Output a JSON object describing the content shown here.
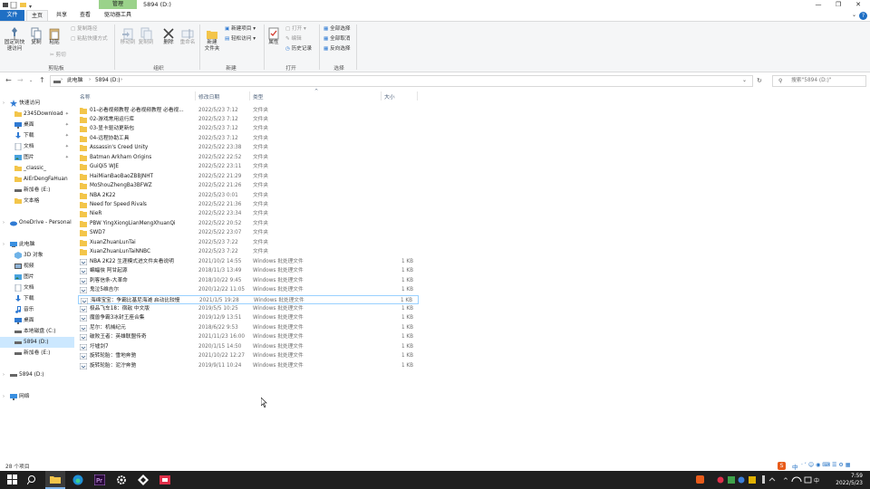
{
  "window": {
    "title": "5894 (D:)",
    "contextual_tab": "管理",
    "buttons": {
      "minimize": "—",
      "restore": "❐",
      "close": "✕"
    }
  },
  "ribbon_tabs": [
    "文件",
    "主页",
    "共享",
    "查看",
    "驱动器工具"
  ],
  "ribbon": {
    "clipboard": {
      "pin": "固定到快\n速访问",
      "copy": "复制",
      "paste": "粘贴",
      "copy_path": "复制路径",
      "paste_shortcut": "粘贴快捷方式",
      "cut": "剪切",
      "label": "剪贴板"
    },
    "organize": {
      "move_to": "移动到",
      "copy_to": "复制到",
      "delete": "删除",
      "rename": "重命名",
      "label": "组织"
    },
    "new": {
      "new_folder": "新建\n文件夹",
      "new_item": "新建项目 ▾",
      "easy_access": "轻松访问 ▾",
      "label": "新建"
    },
    "open": {
      "properties": "属性",
      "open": "打开 ▾",
      "edit": "编辑",
      "history": "历史记录",
      "label": "打开"
    },
    "select": {
      "select_all": "全部选择",
      "select_none": "全部取消",
      "invert": "反向选择",
      "label": "选择"
    }
  },
  "address": {
    "crumbs": [
      "此电脑",
      "5894 (D:)"
    ],
    "search_placeholder": "搜索\"5894 (D:)\""
  },
  "nav_pane": [
    {
      "label": "快速访问",
      "icon": "star-icon",
      "indent": 0,
      "pin": false
    },
    {
      "label": "2345Download",
      "icon": "folder-icon",
      "indent": 1,
      "pin": true
    },
    {
      "label": "桌面",
      "icon": "desktop-icon",
      "indent": 1,
      "pin": true
    },
    {
      "label": "下载",
      "icon": "download-icon",
      "indent": 1,
      "pin": true
    },
    {
      "label": "文档",
      "icon": "document-icon",
      "indent": 1,
      "pin": true
    },
    {
      "label": "图片",
      "icon": "picture-icon",
      "indent": 1,
      "pin": true
    },
    {
      "label": "_classic_",
      "icon": "folder-icon",
      "indent": 1,
      "pin": false
    },
    {
      "label": "AiErDengFaHuan",
      "icon": "folder-icon",
      "indent": 1,
      "pin": false
    },
    {
      "label": "新加卷 (E:)",
      "icon": "drive-icon",
      "indent": 1,
      "pin": false
    },
    {
      "label": "文本格",
      "icon": "folder-icon",
      "indent": 1,
      "pin": false
    },
    {
      "label": "",
      "icon": "",
      "indent": 0,
      "pin": false
    },
    {
      "label": "OneDrive - Personal",
      "icon": "cloud-icon",
      "indent": 0,
      "pin": false
    },
    {
      "label": "",
      "icon": "",
      "indent": 0,
      "pin": false
    },
    {
      "label": "此电脑",
      "icon": "computer-icon",
      "indent": 0,
      "pin": false
    },
    {
      "label": "3D 对象",
      "icon": "cube-icon",
      "indent": 1,
      "pin": false
    },
    {
      "label": "视频",
      "icon": "video-icon",
      "indent": 1,
      "pin": false
    },
    {
      "label": "图片",
      "icon": "picture-icon",
      "indent": 1,
      "pin": false
    },
    {
      "label": "文档",
      "icon": "document-icon",
      "indent": 1,
      "pin": false
    },
    {
      "label": "下载",
      "icon": "download-icon",
      "indent": 1,
      "pin": false
    },
    {
      "label": "音乐",
      "icon": "music-icon",
      "indent": 1,
      "pin": false
    },
    {
      "label": "桌面",
      "icon": "desktop-icon",
      "indent": 1,
      "pin": false
    },
    {
      "label": "本地磁盘 (C:)",
      "icon": "drive-icon",
      "indent": 1,
      "pin": false
    },
    {
      "label": "5894 (D:)",
      "icon": "drive-icon",
      "indent": 1,
      "pin": false,
      "selected": true
    },
    {
      "label": "新加卷 (E:)",
      "icon": "drive-icon",
      "indent": 1,
      "pin": false
    },
    {
      "label": "",
      "icon": "",
      "indent": 0,
      "pin": false
    },
    {
      "label": "5894 (D:)",
      "icon": "drive-icon",
      "indent": 0,
      "pin": false
    },
    {
      "label": "",
      "icon": "",
      "indent": 0,
      "pin": false
    },
    {
      "label": "网络",
      "icon": "network-icon",
      "indent": 0,
      "pin": false
    }
  ],
  "columns": {
    "name": "名称",
    "date": "修改日期",
    "type": "类型",
    "size": "大小"
  },
  "files": [
    {
      "name": "01-必看视频教程 必看视频教程 必看视...",
      "date": "2022/5/23 7:12",
      "type": "文件夹",
      "size": "",
      "kind": "folder"
    },
    {
      "name": "02-游戏常用运行库",
      "date": "2022/5/23 7:12",
      "type": "文件夹",
      "size": "",
      "kind": "folder"
    },
    {
      "name": "03-显卡驱动更新包",
      "date": "2022/5/23 7:12",
      "type": "文件夹",
      "size": "",
      "kind": "folder"
    },
    {
      "name": "04-远程协助工具",
      "date": "2022/5/23 7:12",
      "type": "文件夹",
      "size": "",
      "kind": "folder"
    },
    {
      "name": "Assassin's Creed Unity",
      "date": "2022/5/22 23:38",
      "type": "文件夹",
      "size": "",
      "kind": "folder"
    },
    {
      "name": "Batman Arkham Origins",
      "date": "2022/5/22 22:52",
      "type": "文件夹",
      "size": "",
      "kind": "folder"
    },
    {
      "name": "GuiQi5 WJE",
      "date": "2022/5/22 23:11",
      "type": "文件夹",
      "size": "",
      "kind": "folder"
    },
    {
      "name": "HaiMianBaoBaoZBBJNHT",
      "date": "2022/5/22 21:29",
      "type": "文件夹",
      "size": "",
      "kind": "folder"
    },
    {
      "name": "MoShouZhengBa3BFWZ",
      "date": "2022/5/22 21:26",
      "type": "文件夹",
      "size": "",
      "kind": "folder"
    },
    {
      "name": "NBA 2K22",
      "date": "2022/5/23 0:01",
      "type": "文件夹",
      "size": "",
      "kind": "folder"
    },
    {
      "name": "Need for Speed Rivals",
      "date": "2022/5/22 21:36",
      "type": "文件夹",
      "size": "",
      "kind": "folder"
    },
    {
      "name": "NieR",
      "date": "2022/5/22 23:34",
      "type": "文件夹",
      "size": "",
      "kind": "folder"
    },
    {
      "name": "PBW YingXiongLianMengXhuanQi",
      "date": "2022/5/22 20:52",
      "type": "文件夹",
      "size": "",
      "kind": "folder"
    },
    {
      "name": "SWD7",
      "date": "2022/5/22 23:07",
      "type": "文件夹",
      "size": "",
      "kind": "folder"
    },
    {
      "name": "XuanZhuanLunTai",
      "date": "2022/5/23 7:22",
      "type": "文件夹",
      "size": "",
      "kind": "folder"
    },
    {
      "name": "XuanZhuanLunTaiNNBC",
      "date": "2022/5/23 7:22",
      "type": "文件夹",
      "size": "",
      "kind": "folder"
    },
    {
      "name": "NBA 2K22 生涯模式进文件夹看说明",
      "date": "2021/10/2 14:55",
      "type": "Windows 批处理文件",
      "size": "1 KB",
      "kind": "bat"
    },
    {
      "name": "蝙蝠侠 阿甘起源",
      "date": "2018/11/3 13:49",
      "type": "Windows 批处理文件",
      "size": "1 KB",
      "kind": "bat"
    },
    {
      "name": "刺客信条-大革命",
      "date": "2018/10/22 9:45",
      "type": "Windows 批处理文件",
      "size": "1 KB",
      "kind": "bat"
    },
    {
      "name": "鬼泣5维吉尔",
      "date": "2020/12/22 11:05",
      "type": "Windows 批处理文件",
      "size": "1 KB",
      "kind": "bat"
    },
    {
      "name": "海绵宝宝：争霸比基尼海滩 启动比较慢",
      "date": "2021/1/5 19:28",
      "type": "Windows 批处理文件",
      "size": "1 KB",
      "kind": "bat",
      "hover": true
    },
    {
      "name": "极品飞车18：宿敌 中文版",
      "date": "2019/5/5 10:25",
      "type": "Windows 批处理文件",
      "size": "1 KB",
      "kind": "bat"
    },
    {
      "name": "魔兽争霸3冰封王座合集",
      "date": "2019/12/9 13:51",
      "type": "Windows 批处理文件",
      "size": "1 KB",
      "kind": "bat"
    },
    {
      "name": "尼尔：机械纪元",
      "date": "2018/6/22 9:53",
      "type": "Windows 批处理文件",
      "size": "1 KB",
      "kind": "bat"
    },
    {
      "name": "破败王者：英雄联盟传奇",
      "date": "2021/11/23 16:00",
      "type": "Windows 批处理文件",
      "size": "1 KB",
      "kind": "bat"
    },
    {
      "name": "圩墟剑7",
      "date": "2020/1/15 14:50",
      "type": "Windows 批处理文件",
      "size": "1 KB",
      "kind": "bat"
    },
    {
      "name": "旋转轮胎：雪地奔驰",
      "date": "2021/10/22 12:27",
      "type": "Windows 批处理文件",
      "size": "1 KB",
      "kind": "bat"
    },
    {
      "name": "旋转轮胎：泥泞奔驰",
      "date": "2019/9/11 10:24",
      "type": "Windows 批处理文件",
      "size": "1 KB",
      "kind": "bat"
    }
  ],
  "status": {
    "item_count": "28 个项目"
  },
  "ime": {
    "label": "中"
  },
  "taskbar": {
    "time": "7:59",
    "date": "2022/5/23"
  },
  "colors": {
    "accent": "#1f6fc4",
    "manage_tab": "#9ad28a",
    "folder": "#f3c54a",
    "selected": "#cce8ff",
    "taskbar": "#1f1f1f"
  }
}
